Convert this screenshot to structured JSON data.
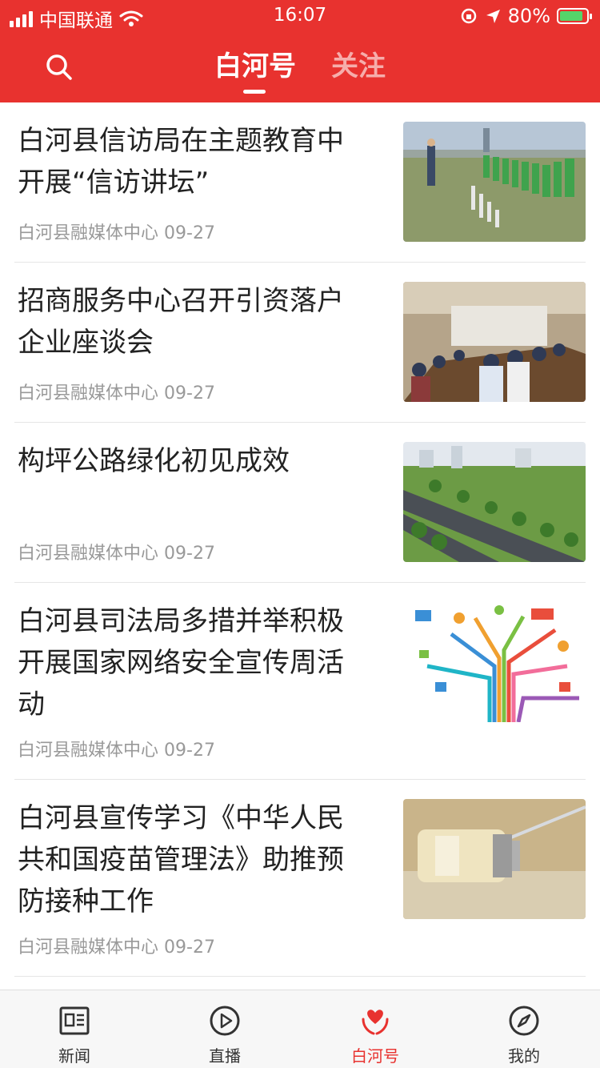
{
  "status_bar": {
    "carrier": "中国联通",
    "time": "16:07",
    "battery": "80%"
  },
  "header": {
    "tabs": [
      {
        "label": "白河号",
        "active": true
      },
      {
        "label": "关注",
        "active": false
      }
    ]
  },
  "feed": [
    {
      "title": "白河县信访局在主题教育中开展“信访讲坛”",
      "source": "白河县融媒体中心",
      "date": "09-27"
    },
    {
      "title": "招商服务中心召开引资落户企业座谈会",
      "source": "白河县融媒体中心",
      "date": "09-27"
    },
    {
      "title": "构坪公路绿化初见成效",
      "source": "白河县融媒体中心",
      "date": "09-27"
    },
    {
      "title": "白河县司法局多措并举积极开展国家网络安全宣传周活动",
      "source": "白河县融媒体中心",
      "date": "09-27"
    },
    {
      "title": "白河县宣传学习《中华人民共和国疫苗管理法》助推预防接种工作",
      "source": "白河县融媒体中心",
      "date": "09-27"
    }
  ],
  "tabbar": [
    {
      "label": "新闻",
      "icon": "news-icon"
    },
    {
      "label": "直播",
      "icon": "play-icon"
    },
    {
      "label": "白河号",
      "icon": "heart-hands-icon",
      "active": true
    },
    {
      "label": "我的",
      "icon": "compass-icon"
    }
  ],
  "colors": {
    "brand": "#e8322f",
    "meta": "#999999"
  }
}
